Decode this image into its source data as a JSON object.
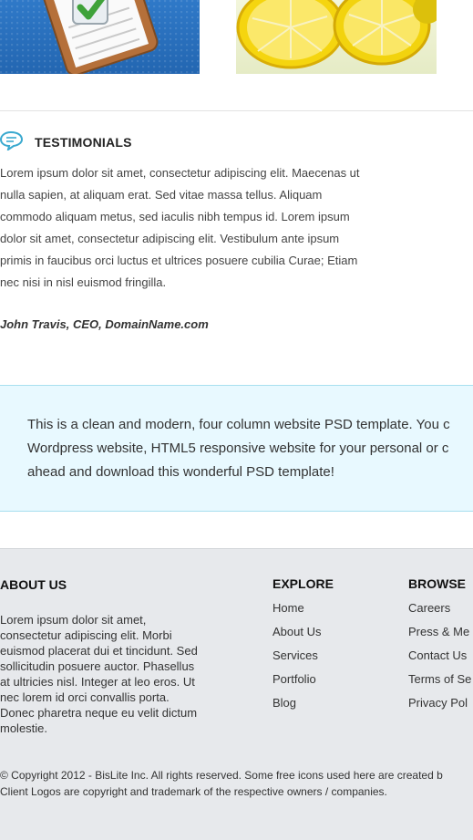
{
  "portfolio": {
    "items": [
      {
        "icon": "checklist-clipboard-icon"
      },
      {
        "icon": "lemon-slices-image"
      }
    ]
  },
  "testimonials": {
    "title": "TESTIMONIALS",
    "icon": "speech-bubble-icon",
    "lines": [
      "Lorem ipsum dolor sit amet, consectetur adipiscing elit. Maecenas ut",
      "nulla sapien, at aliquam erat. Sed vitae massa tellus. Aliquam",
      "commodo aliquam metus, sed iaculis nibh tempus id. Lorem ipsum",
      "dolor sit amet, consectetur adipiscing elit. Vestibulum ante ipsum",
      "primis in faucibus orci luctus et ultrices posuere cubilia Curae; Etiam",
      "nec nisi in nisl euismod fringilla."
    ],
    "author": "John Travis, CEO, DomainName.com"
  },
  "promo": {
    "lines": [
      "This is a clean and modern, four column website PSD template. You c",
      "Wordpress website, HTML5 responsive website for your personal or c",
      "ahead and download this wonderful PSD template!"
    ]
  },
  "footer": {
    "about": {
      "title": "ABOUT US",
      "lines": [
        "Lorem ipsum dolor sit amet,",
        "consectetur adipiscing elit. Morbi",
        "euismod placerat dui et tincidunt. Sed",
        "sollicitudin posuere auctor. Phasellus",
        "at ultricies nisl. Integer at leo eros. Ut",
        "nec lorem id orci convallis porta.",
        "Donec pharetra neque eu velit dictum",
        "molestie."
      ]
    },
    "explore": {
      "title": "EXPLORE",
      "links": [
        "Home",
        "About Us",
        "Services",
        "Portfolio",
        "Blog"
      ]
    },
    "browse": {
      "title": "BROWSE",
      "links": [
        "Careers",
        "Press & Me",
        "Contact Us",
        "Terms of Se",
        "Privacy Pol"
      ]
    },
    "copyright": [
      "© Copyright 2012 - BisLite Inc. All rights reserved. Some free icons used here are created b",
      "Client Logos are copyright and trademark of the respective owners / companies."
    ]
  },
  "colors": {
    "promo_bg": "#e8f9ff",
    "promo_border": "#a8dfef",
    "footer_bg": "#e7e9ec",
    "accent_icon": "#3aa9cf"
  }
}
